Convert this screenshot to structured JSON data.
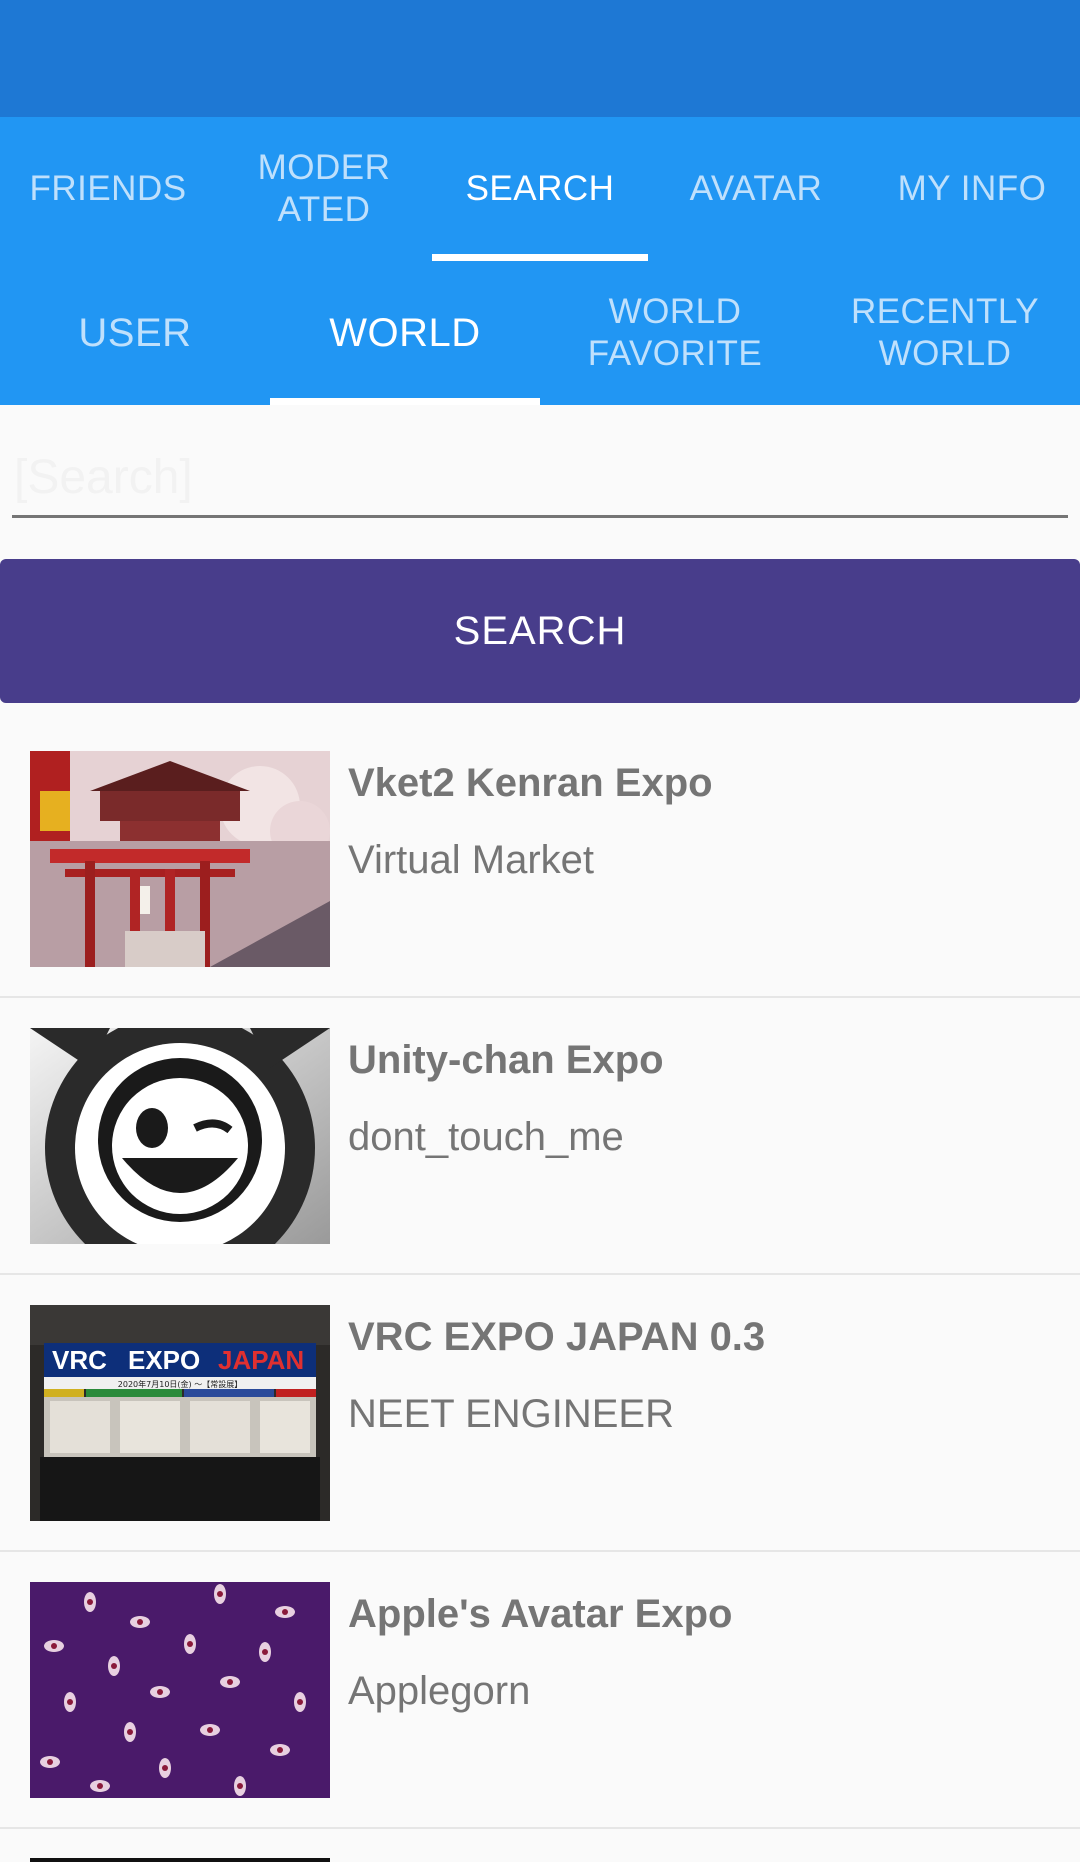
{
  "main_tabs": [
    {
      "label": "FRIENDS",
      "active": false
    },
    {
      "label": "MODER\nATED",
      "active": false
    },
    {
      "label": "SEARCH",
      "active": true
    },
    {
      "label": "AVATAR",
      "active": false
    },
    {
      "label": "MY INFO",
      "active": false
    }
  ],
  "sub_tabs": [
    {
      "label": "USER",
      "active": false
    },
    {
      "label": "WORLD",
      "active": true
    },
    {
      "label": "WORLD\nFAVORITE",
      "active": false
    },
    {
      "label": "RECENTLY\nWORLD",
      "active": false
    }
  ],
  "search": {
    "placeholder": "[Search]",
    "value": "",
    "button_label": "SEARCH"
  },
  "results": [
    {
      "world": "Vket2 Kenran Expo",
      "author": "Virtual Market",
      "thumbnail": "torii-gate-shrine-image"
    },
    {
      "world": "Unity-chan Expo",
      "author": "dont_touch_me",
      "thumbnail": "unity-chan-logo-image"
    },
    {
      "world": "VRC EXPO JAPAN 0.3",
      "author": "NEET ENGINEER",
      "thumbnail": "vrc-expo-japan-booths-image",
      "thumbnail_text": {
        "title_a": "VRC",
        "title_b": "EXPO",
        "title_c": "JAPAN",
        "date": "2020年7月10日(金) 〜【常設展】"
      }
    },
    {
      "world": "Apple's Avatar Expo",
      "author": "Applegorn",
      "thumbnail": "purple-eyes-pattern-image"
    }
  ],
  "colors": {
    "status_bar": "#1e78d4",
    "tab_bar": "#2196f3",
    "tab_inactive_text": "#bfe0fc",
    "search_button": "#483d8b",
    "list_text": "#757575"
  }
}
